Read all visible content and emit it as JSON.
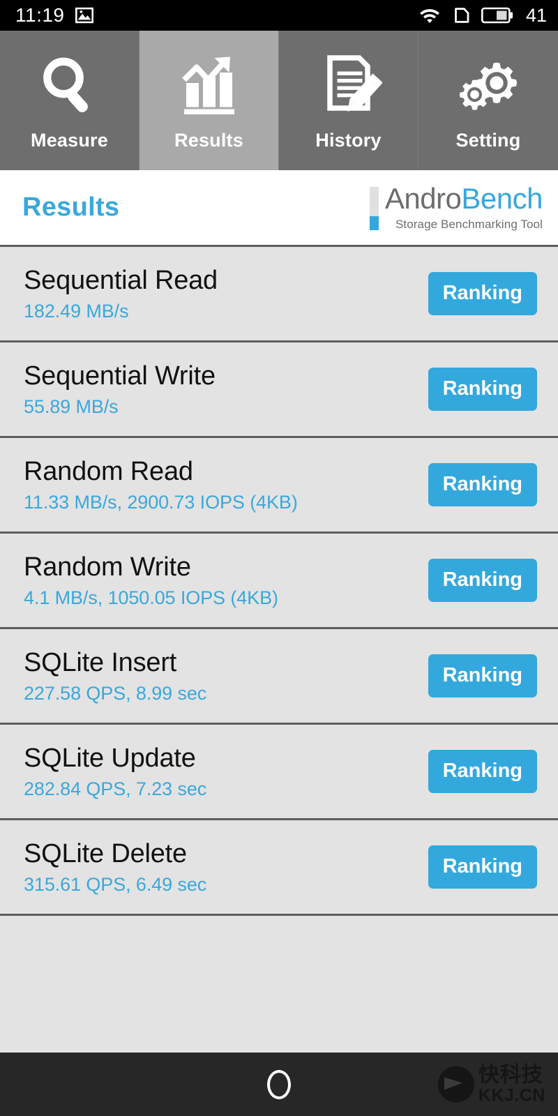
{
  "statusbar": {
    "time": "11:19",
    "icons": [
      "image-icon",
      "wifi-icon",
      "sim-card-icon",
      "battery-icon"
    ],
    "battery_level": "41"
  },
  "tabs": [
    {
      "label": "Measure",
      "icon": "magnifier-icon",
      "selected": false
    },
    {
      "label": "Results",
      "icon": "bar-chart-arrow-icon",
      "selected": true
    },
    {
      "label": "History",
      "icon": "document-pencil-icon",
      "selected": false
    },
    {
      "label": "Setting",
      "icon": "gears-icon",
      "selected": false
    }
  ],
  "header": {
    "title": "Results",
    "logo_name_part1": "Andro",
    "logo_name_part2": "Bench",
    "logo_tagline": "Storage Benchmarking Tool"
  },
  "colors": {
    "accent_blue": "#33a8dd",
    "logo_gray": "#6d6d6d",
    "tab_bg": "#6e6e6e",
    "tab_selected_bg": "#a9a9a9",
    "list_bg": "#e3e3e3",
    "separator": "#5d5d5d"
  },
  "results": {
    "button_label": "Ranking",
    "rows": [
      {
        "name": "Sequential Read",
        "value": "182.49 MB/s"
      },
      {
        "name": "Sequential Write",
        "value": "55.89 MB/s"
      },
      {
        "name": "Random Read",
        "value": "11.33 MB/s, 2900.73 IOPS (4KB)"
      },
      {
        "name": "Random Write",
        "value": "4.1 MB/s, 1050.05 IOPS (4KB)"
      },
      {
        "name": "SQLite Insert",
        "value": "227.58 QPS, 8.99 sec"
      },
      {
        "name": "SQLite Update",
        "value": "282.84 QPS, 7.23 sec"
      },
      {
        "name": "SQLite Delete",
        "value": "315.61 QPS, 6.49 sec"
      }
    ]
  },
  "navbar": {
    "home_icon": "home-circle-icon",
    "watermark_cn": "快科技",
    "watermark_url": "KKJ.CN"
  }
}
